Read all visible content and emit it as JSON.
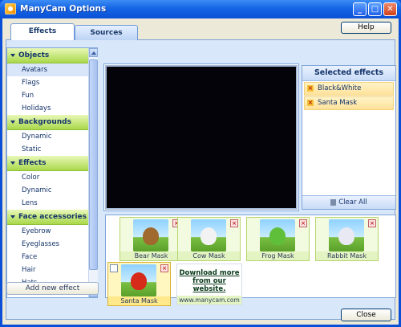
{
  "window": {
    "title": "ManyCam Options"
  },
  "tabs": [
    {
      "label": "Effects",
      "active": true
    },
    {
      "label": "Sources",
      "active": false
    }
  ],
  "buttons": {
    "help": "Help",
    "close": "Close",
    "add_new_effect": "Add new effect",
    "clear_all": "Clear All"
  },
  "categories": [
    {
      "title": "Objects",
      "items": [
        "Avatars",
        "Flags",
        "Fun",
        "Holidays"
      ],
      "selected": "Avatars"
    },
    {
      "title": "Backgrounds",
      "items": [
        "Dynamic",
        "Static"
      ]
    },
    {
      "title": "Effects",
      "items": [
        "Color",
        "Dynamic",
        "Lens"
      ]
    },
    {
      "title": "Face accessories",
      "items": [
        "Eyebrow",
        "Eyeglasses",
        "Face",
        "Hair",
        "Hats"
      ]
    }
  ],
  "selected_effects": {
    "title": "Selected effects",
    "items": [
      "Black&White",
      "Santa Mask"
    ]
  },
  "avatars": [
    {
      "label": "Bear Mask",
      "face_color": "#a0692e",
      "selected": false
    },
    {
      "label": "Cow Mask",
      "face_color": "#f2f2f2",
      "selected": false
    },
    {
      "label": "Frog Mask",
      "face_color": "#5fbf3a",
      "selected": false
    },
    {
      "label": "Rabbit Mask",
      "face_color": "#e9e9f3",
      "selected": false
    },
    {
      "label": "Santa Mask",
      "face_color": "#d62a1a",
      "selected": true
    }
  ],
  "download": {
    "text": "Download more from our website.",
    "url": "www.manycam.com"
  },
  "colors": {
    "titlebar": "#1565e6",
    "category_green": "#a9d84a",
    "panel": "#d8e7fa"
  }
}
